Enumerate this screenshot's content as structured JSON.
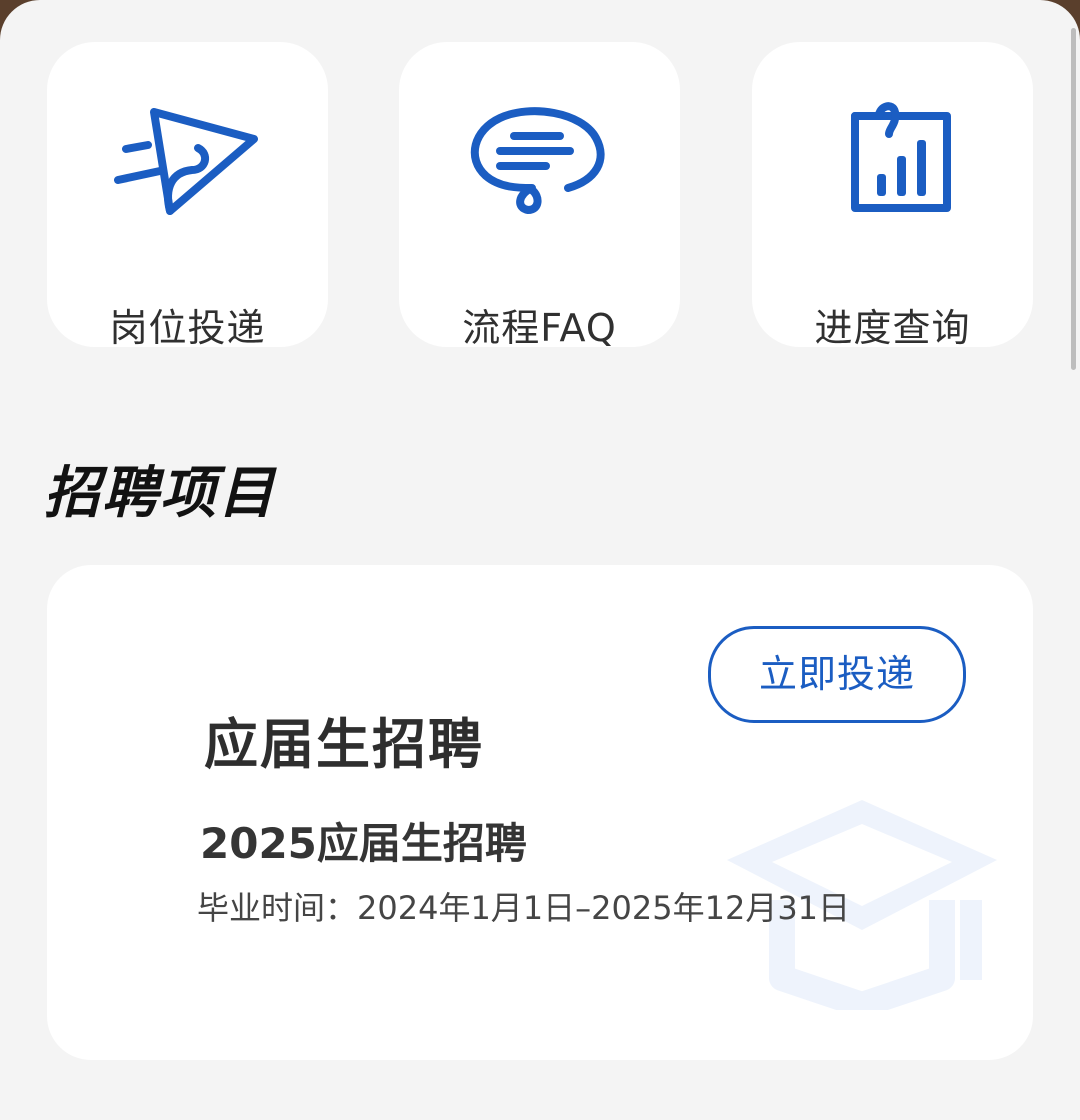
{
  "quick_actions": [
    {
      "label": "岗位投递",
      "icon": "paper-plane-icon"
    },
    {
      "label": "流程FAQ",
      "icon": "chat-bubble-icon"
    },
    {
      "label": "进度查询",
      "icon": "bar-chart-document-icon"
    }
  ],
  "section": {
    "title": "招聘项目"
  },
  "card": {
    "title": "应届生招聘",
    "apply_label": "立即投递",
    "subtitle": "2025应届生招聘",
    "dates": "毕业时间：2024年1月1日–2025年12月31日",
    "watermark_icon": "graduation-cap-icon"
  },
  "colors": {
    "accent": "#1b5dc2",
    "background": "#f4f4f4",
    "card": "#ffffff"
  }
}
